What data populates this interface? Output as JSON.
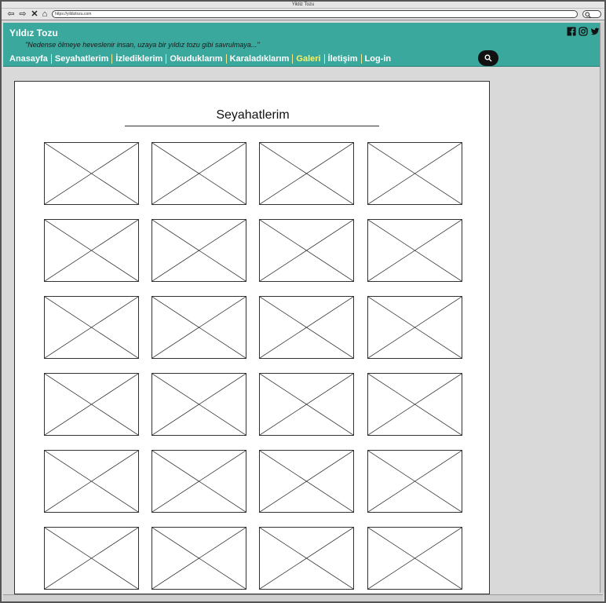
{
  "browser": {
    "title": "Yildiz Tozu",
    "url": "https://yildiztozu.com"
  },
  "header": {
    "site_title": "Yıldız Tozu",
    "tagline": "\"Nedense ölmeye heveslenir insan, uzaya bir yıldız tozu gibi savrulmaya...\"",
    "social": [
      "facebook-icon",
      "instagram-icon",
      "twitter-icon"
    ]
  },
  "nav": {
    "items": [
      {
        "label": "Anasayfa"
      },
      {
        "label": "Seyahatlerim"
      },
      {
        "label": "İzlediklerim"
      },
      {
        "label": "Okuduklarım"
      },
      {
        "label": "Karaladıklarım"
      },
      {
        "label": "Galeri",
        "active": true
      },
      {
        "label": "İletişim"
      },
      {
        "label": "Log-in"
      }
    ]
  },
  "colors": {
    "header_bg": "#3aa89c",
    "nav_active": "#f7f36b",
    "nav_text": "#ffffff"
  },
  "main": {
    "page_title": "Seyahatlerim",
    "image_placeholder_count": 24
  }
}
